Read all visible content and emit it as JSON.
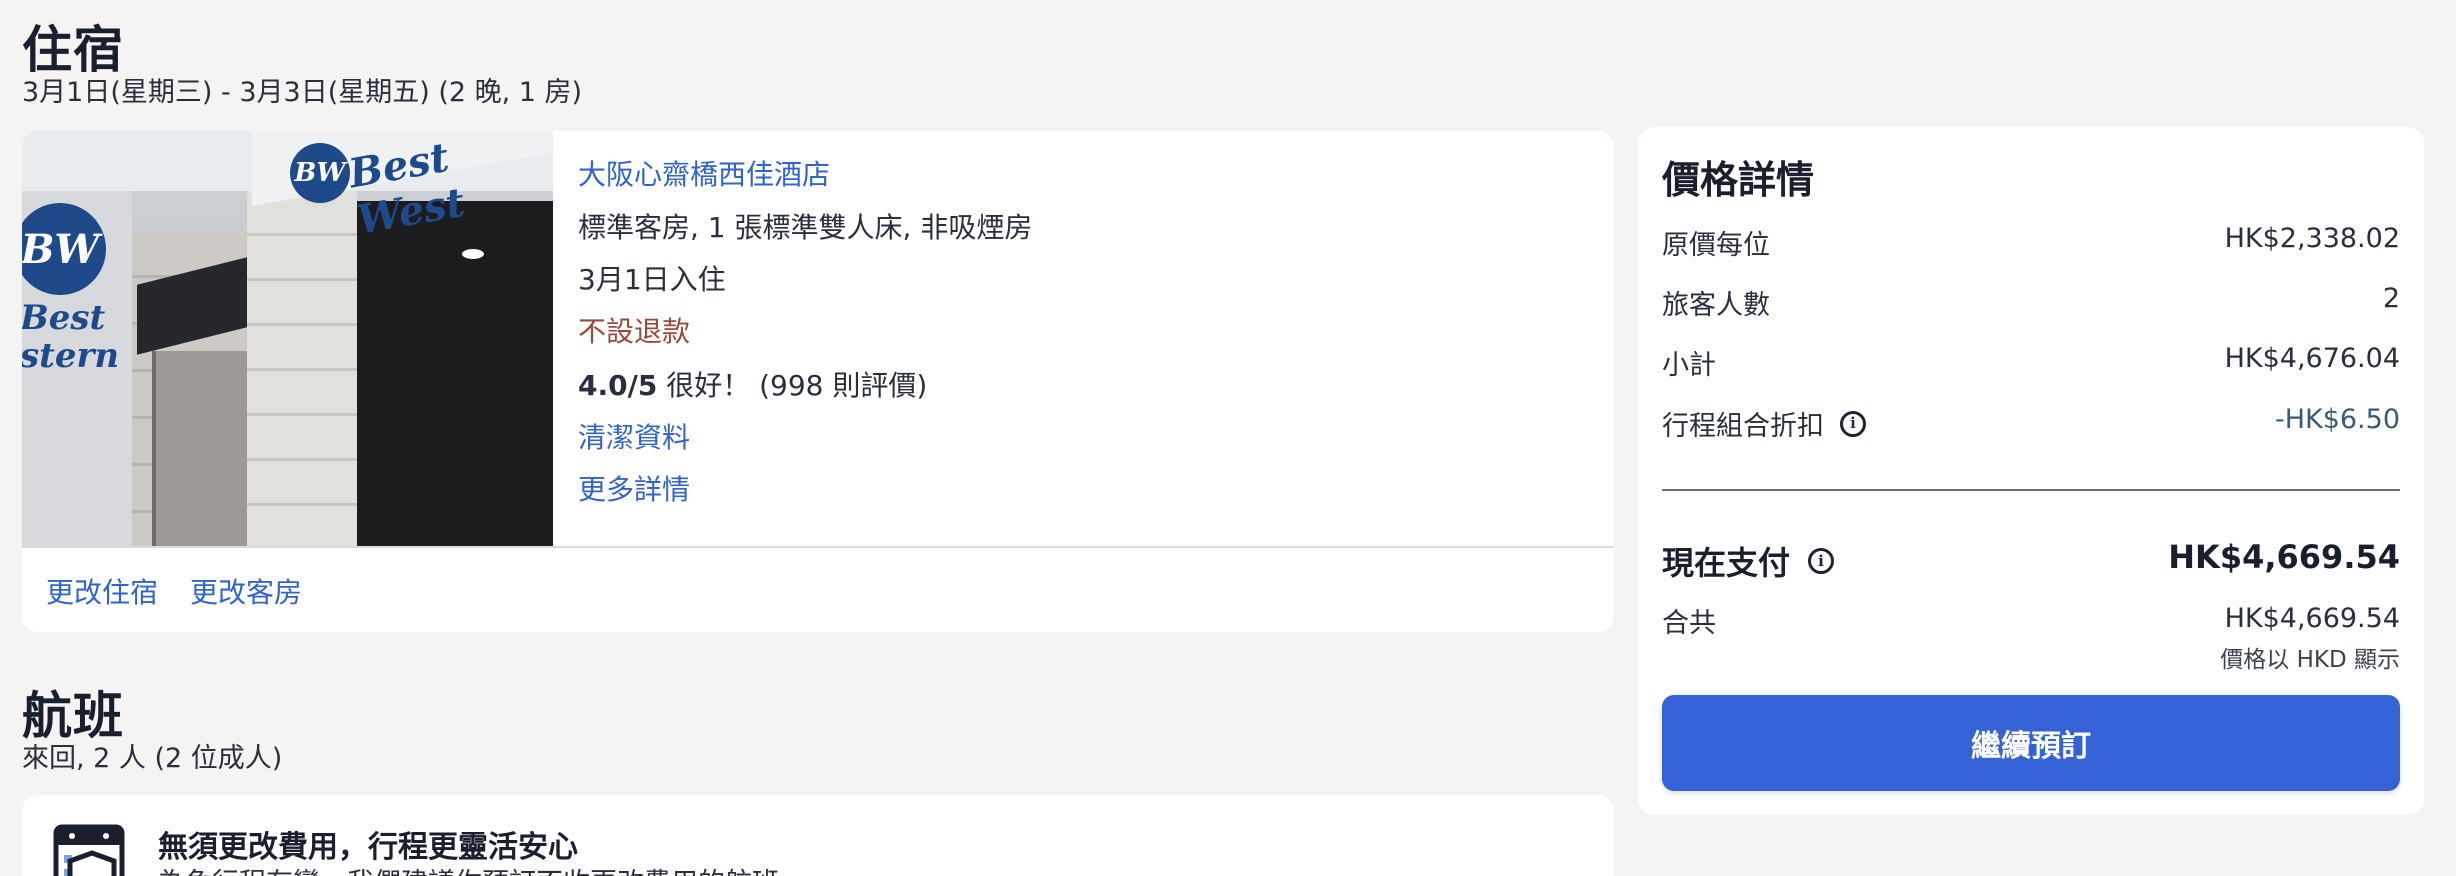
{
  "stay": {
    "title": "住宿",
    "dates": "3月1日(星期三) - 3月3日(星期五) (2 晚, 1 房)",
    "hotel": {
      "photo_icon": "hotel-photo",
      "name": "大阪心齋橋西佳酒店",
      "room": "標準客房, 1 張標準雙人床, 非吸煙房",
      "checkin": "3月1日入住",
      "refund": "不設退款",
      "rating_score": "4.0/5",
      "rating_text": " 很好！ (998 則評價)",
      "cleaning_link": "清潔資料",
      "more_link": "更多詳情"
    },
    "actions": {
      "change_stay": "更改住宿",
      "change_room": "更改客房"
    }
  },
  "flight": {
    "title": "航班",
    "sub": "來回, 2 人 (2 位成人)",
    "banner": {
      "icon": "calendar-shield-icon",
      "heading": "無須更改費用，行程更靈活安心",
      "body": "為免行程有變，我們建議你預訂不收更改費用的航班"
    }
  },
  "price": {
    "title": "價格詳情",
    "rows": [
      {
        "label": "原價每位",
        "value": "HK$2,338.02"
      },
      {
        "label": "旅客人數",
        "value": "2"
      },
      {
        "label": "小計",
        "value": "HK$4,676.04"
      },
      {
        "label": "行程組合折扣",
        "value": "-HK$6.50"
      }
    ],
    "pay_now_label": "現在支付",
    "pay_now_value": "HK$4,669.54",
    "total_label": "合共",
    "total_value": "HK$4,669.54",
    "currency_note": "價格以 HKD 顯示",
    "continue_label": "繼續預訂"
  },
  "colors": {
    "link": "#3163c9",
    "refund": "#9a4a3a",
    "button": "#3562d6",
    "background": "#f5f4f2"
  }
}
